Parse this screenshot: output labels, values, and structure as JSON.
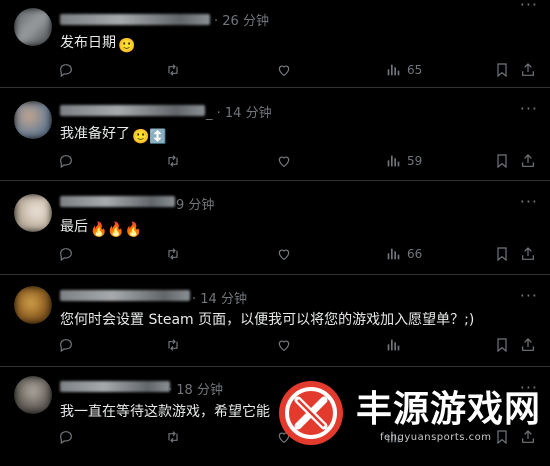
{
  "replies": [
    {
      "time": "26 分钟",
      "text": "发布日期",
      "emoji": "🙂",
      "views": "65"
    },
    {
      "time": "14 分钟",
      "text": "我准备好了",
      "emoji": "🙂↕️",
      "views": "59"
    },
    {
      "time": "9 分钟",
      "text": "最后",
      "emoji": "🔥🔥🔥",
      "views": "66"
    },
    {
      "time": "14 分钟",
      "text": "您何时会设置 Steam 页面，以便我可以将您的游戏加入愿望单？;)",
      "emoji": "",
      "views": ""
    },
    {
      "time": "18 分钟",
      "text": "我一直在等待这款游戏，希望它能",
      "emoji": "",
      "views": ""
    }
  ],
  "icons": {
    "reply": "reply-icon",
    "retweet": "retweet-icon",
    "like": "heart-icon",
    "views": "views-icon",
    "bookmark": "bookmark-icon",
    "share": "share-icon",
    "more": "more-icon"
  },
  "watermark": {
    "brand": "丰源游戏网",
    "url": "fengyuansports.com"
  },
  "colors": {
    "background": "#000000",
    "text": "#e7e9ea",
    "muted": "#71767b",
    "divider": "#2f3336",
    "watermark_red": "#e23b2e"
  }
}
